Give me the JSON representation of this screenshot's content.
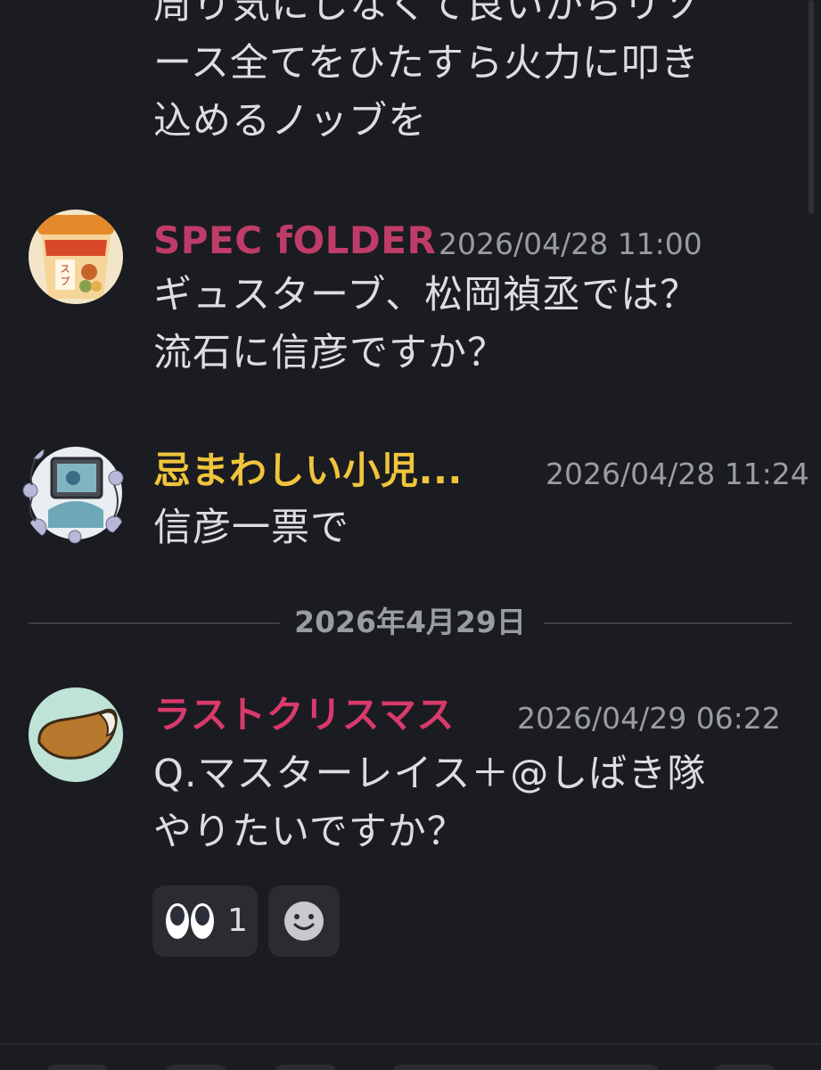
{
  "messages": {
    "continuation": {
      "lines": [
        "周り気にしなくて良いからリソ",
        "ース全てをひたすら火力に叩き",
        "込めるノッブを"
      ]
    },
    "spec": {
      "username": "SPEC fOLDER",
      "username_color": "#c03c68",
      "timestamp": "2026/04/28 11:00",
      "avatar_icon": "soup-cup-avatar-icon",
      "lines": [
        "ギュスターブ、松岡禎丞では？",
        "流石に信彦ですか？"
      ]
    },
    "imawashii": {
      "username": "忌まわしい小児...",
      "username_color": "#f0c43b",
      "timestamp": "2026/04/28 11:24",
      "avatar_icon": "rose-frame-avatar-icon",
      "lines": [
        "信彦一票で"
      ]
    },
    "last_christmas": {
      "username": "ラストクリスマス",
      "username_color": "#d93a6b",
      "timestamp": "2026/04/29 06:22",
      "avatar_icon": "fox-tail-avatar-icon",
      "lines": [
        "Q.マスターレイス＋@しばき隊",
        "やりたいですか？"
      ],
      "reactions": [
        {
          "emoji": "eyes-icon",
          "count": "1"
        },
        {
          "emoji": "add-reaction-icon",
          "count": ""
        }
      ]
    }
  },
  "date_divider": {
    "label": "2026年4月29日"
  },
  "colors": {
    "background": "#1b1c21",
    "text": "#dcdde0",
    "muted": "#9a9ca3",
    "reaction_bg": "#2a2c32"
  }
}
